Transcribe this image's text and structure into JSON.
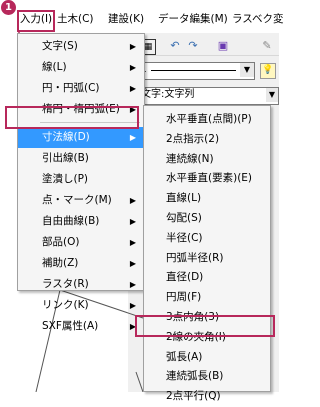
{
  "menubar": {
    "badge": "1",
    "items": [
      "入力(I)",
      "土木(C)",
      "建設(K)",
      "データ編集(M)",
      "ラスベク変"
    ]
  },
  "toolbar": {
    "icons": [
      "grid-icon",
      "undo-icon",
      "redo-icon",
      "layer-icon",
      "pencil-icon"
    ],
    "combo_value": "1",
    "status_field": "文字:文字列"
  },
  "menu1": {
    "items": [
      {
        "label": "文字(S)",
        "arrow": true
      },
      {
        "label": "線(L)",
        "arrow": true
      },
      {
        "label": "円・円弧(C)",
        "arrow": true
      },
      {
        "label": "楕円・楕円弧(E)",
        "arrow": true
      },
      {
        "label": "寸法線(D)",
        "arrow": true,
        "selected": true
      },
      {
        "label": "引出線(B)",
        "arrow": false
      },
      {
        "label": "塗潰し(P)",
        "arrow": false
      },
      {
        "label": "点・マーク(M)",
        "arrow": true
      },
      {
        "label": "自由曲線(B)",
        "arrow": true
      },
      {
        "label": "部品(O)",
        "arrow": true
      },
      {
        "label": "補助(Z)",
        "arrow": true
      },
      {
        "label": "ラスタ(R)",
        "arrow": true
      },
      {
        "label": "リンク(K)",
        "arrow": true
      },
      {
        "label": "SXF属性(A)",
        "arrow": true
      }
    ]
  },
  "menu2": {
    "items": [
      "水平垂直(点間)(P)",
      "2点指示(2)",
      "連続線(N)",
      "水平垂直(要素)(E)",
      "直線(L)",
      "勾配(S)",
      "半径(C)",
      "円弧半径(R)",
      "直径(D)",
      "円周(F)",
      "3点内角(3)",
      "2線の夾角(I)",
      "弧長(A)",
      "連続弧長(B)",
      "2点平行(Q)"
    ],
    "highlighted_index": 11
  },
  "colors": {
    "callout": "#b7285b",
    "selection": "#3399ff"
  }
}
